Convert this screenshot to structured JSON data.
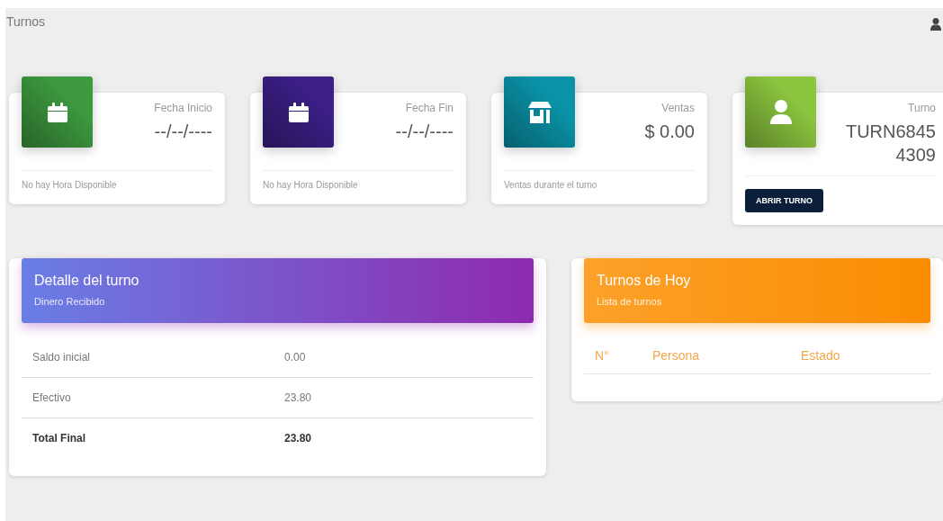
{
  "page_title": "Turnos",
  "stats": [
    {
      "kind": "calendar",
      "color": "#3d9a3f",
      "label": "Fecha Inicio",
      "value": "--/--/----",
      "footer": "No hay Hora Disponible"
    },
    {
      "kind": "calendar",
      "color": "#3b1f86",
      "label": "Fecha Fin",
      "value": "--/--/----",
      "footer": "No hay Hora Disponible"
    },
    {
      "kind": "store",
      "color": "#0a93a8",
      "label": "Ventas",
      "value": "$ 0.00",
      "footer": "Ventas durante el turno"
    },
    {
      "kind": "person",
      "color": "#8cc63f",
      "label": "Turno",
      "value": "TURN6845 4309",
      "button": "ABRIR TURNO"
    }
  ],
  "detail": {
    "title": "Detalle del turno",
    "subtitle": "Dinero Recibido",
    "rows": [
      {
        "label": "Saldo inicial",
        "value": "0.00",
        "total": false
      },
      {
        "label": "Efectivo",
        "value": "23.80",
        "total": false
      },
      {
        "label": "Total Final",
        "value": "23.80",
        "total": true
      }
    ]
  },
  "today": {
    "title": "Turnos de Hoy",
    "subtitle": "Lista de turnos",
    "columns": [
      "N°",
      "Persona",
      "Estado"
    ]
  }
}
